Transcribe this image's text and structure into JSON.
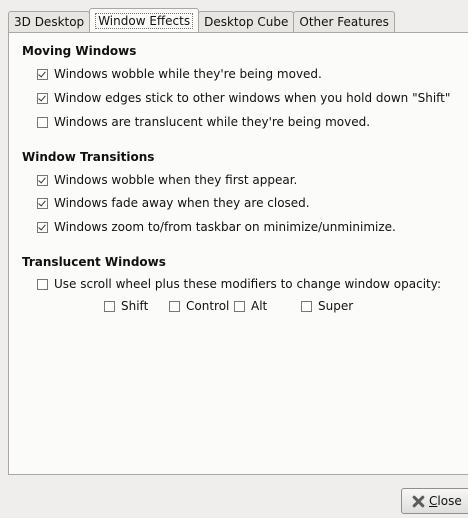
{
  "tabs": [
    {
      "label": "3D Desktop",
      "active": false
    },
    {
      "label": "Window Effects",
      "active": true
    },
    {
      "label": "Desktop Cube",
      "active": false
    },
    {
      "label": "Other Features",
      "active": false
    }
  ],
  "moving": {
    "title": "Moving Windows",
    "options": [
      {
        "label": "Windows wobble while they're being moved.",
        "checked": true
      },
      {
        "label": "Window edges stick to other windows when you hold down \"Shift\"",
        "checked": true
      },
      {
        "label": "Windows are translucent while they're being moved.",
        "checked": false
      }
    ]
  },
  "transitions": {
    "title": "Window Transitions",
    "options": [
      {
        "label": "Windows wobble when they first appear.",
        "checked": true
      },
      {
        "label": "Windows fade away when they are closed.",
        "checked": true
      },
      {
        "label": "Windows zoom to/from taskbar on minimize/unminimize.",
        "checked": true
      }
    ]
  },
  "translucent": {
    "title": "Translucent Windows",
    "scroll_option": {
      "label": "Use scroll wheel plus these modifiers to change window opacity:",
      "checked": false
    },
    "modifiers": [
      {
        "label": "Shift",
        "checked": false
      },
      {
        "label": "Control",
        "checked": false
      },
      {
        "label": "Alt",
        "checked": false
      },
      {
        "label": "Super",
        "checked": false
      }
    ]
  },
  "footer": {
    "close_mnemonic": "C",
    "close_rest": "lose",
    "close_icon": "close-icon"
  }
}
